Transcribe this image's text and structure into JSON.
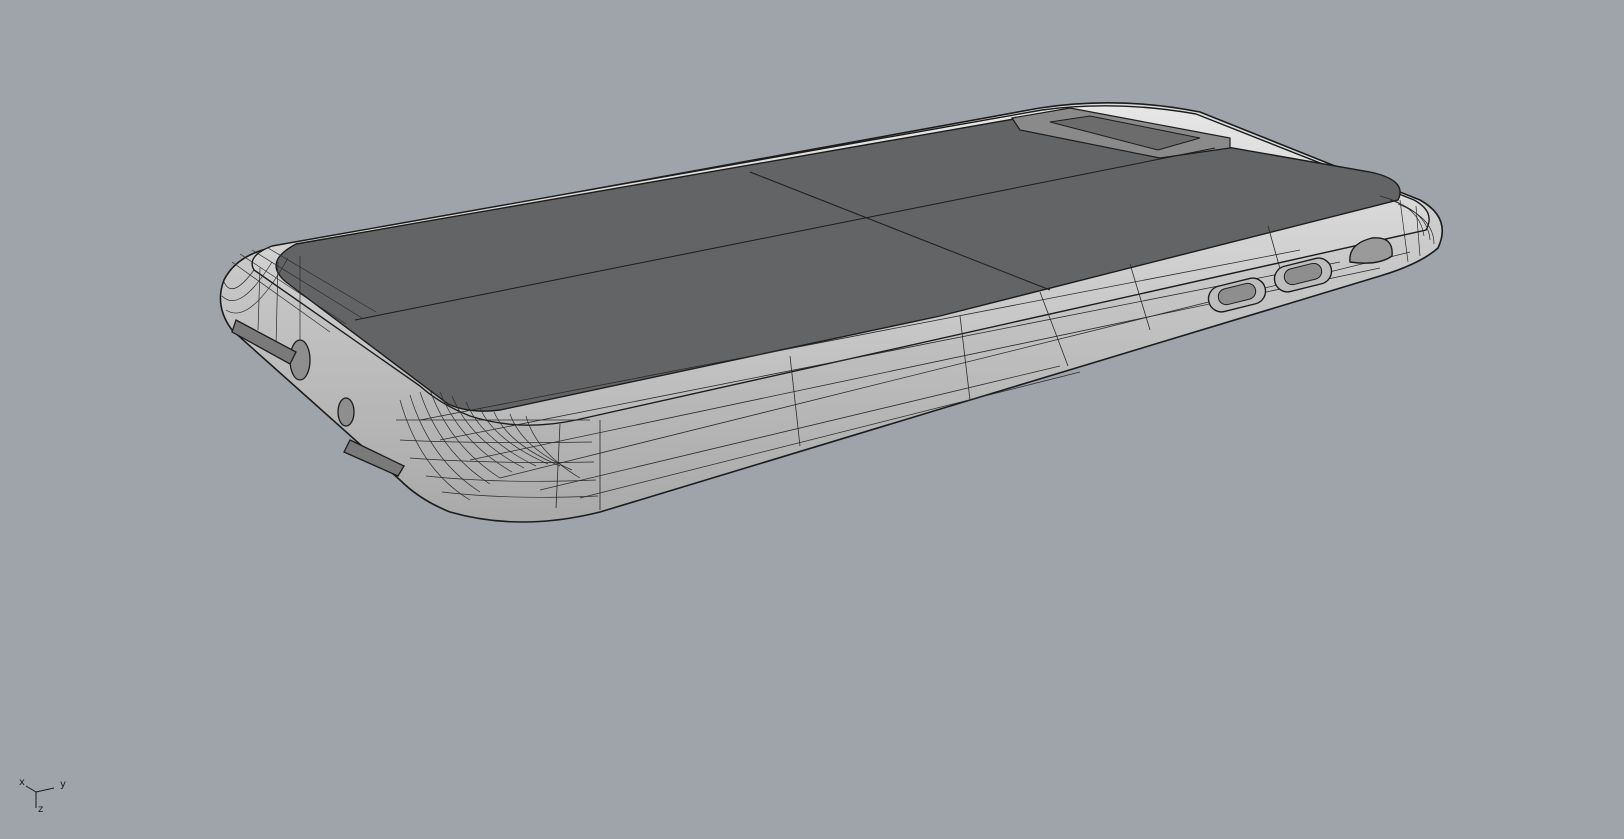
{
  "viewport": {
    "background": "#9ea4aa",
    "display_mode": "shaded-wireframe"
  },
  "model": {
    "name": "phone-case",
    "shell_color": "#d2d2d2",
    "panel_color": "#636466",
    "wire_color": "#1c1c1c"
  },
  "axes": {
    "x_label": "x",
    "y_label": "y",
    "z_label": "z"
  }
}
